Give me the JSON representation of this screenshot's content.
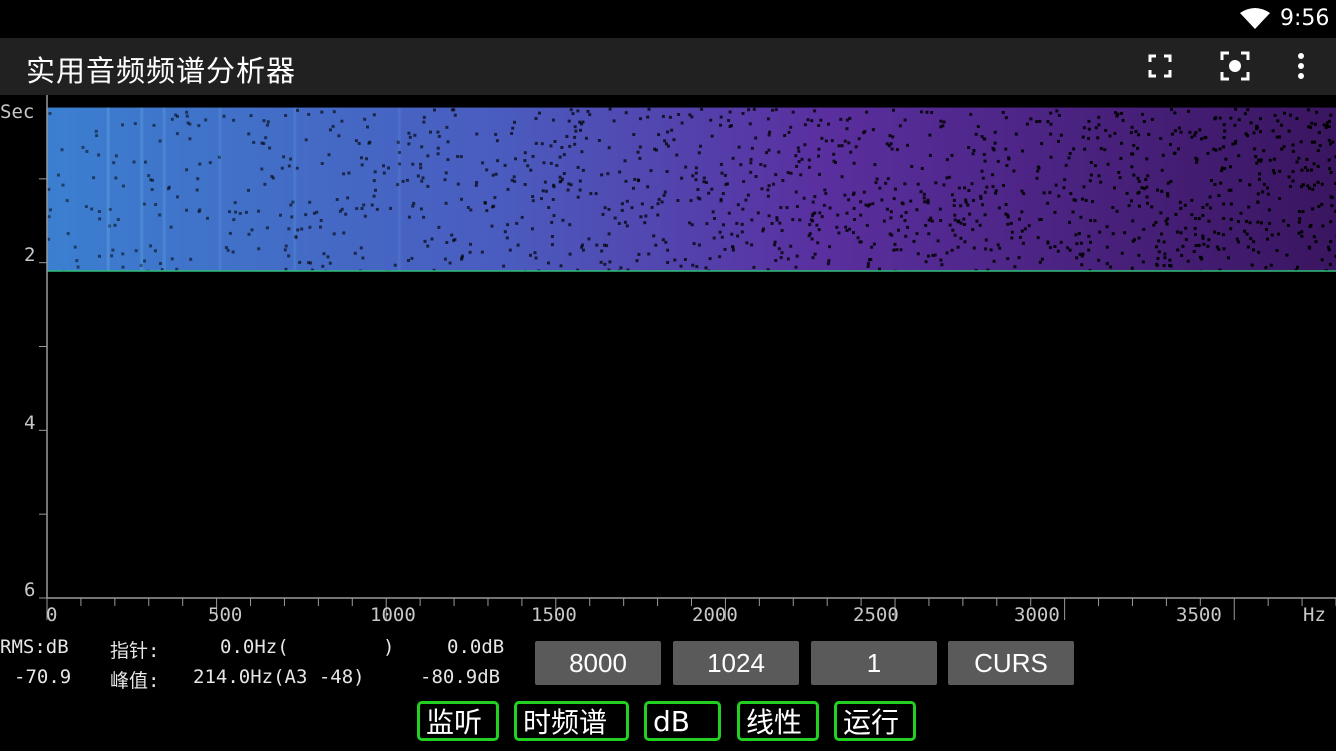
{
  "status_bar": {
    "time": "9:56",
    "wifi_icon": "wifi-icon"
  },
  "app_bar": {
    "title": "实用音频频谱分析器",
    "actions": [
      "fullscreen-icon",
      "screenshot-icon",
      "more-vert-icon"
    ]
  },
  "plot": {
    "y_axis": {
      "unit": "Sec",
      "labels": [
        "2",
        "4",
        "6"
      ],
      "range_sec": [
        0,
        6
      ]
    },
    "x_axis": {
      "unit": "Hz",
      "labels": [
        "0",
        "500",
        "1000",
        "1500",
        "2000",
        "2500",
        "3000",
        "3500"
      ],
      "range_hz": [
        0,
        3800
      ]
    },
    "spectrogram": {
      "filled_from_sec": 0.15,
      "filled_to_sec": 2.1,
      "cursor_sec": 2.1
    },
    "colors": {
      "low": "#6a2a9a",
      "high": "#3b7fd0",
      "cursor_line": "#2fc07a",
      "axis": "#9a9a9a"
    }
  },
  "readout": {
    "line1": {
      "rms_label": "RMS:dB",
      "pointer_label": "指针:",
      "pointer_freq": "0.0Hz(",
      "pointer_note": ")",
      "pointer_db": "0.0dB"
    },
    "line2": {
      "rms_value": "-70.9",
      "peak_label": "峰值:",
      "peak_freq": "214.0Hz(A3 -48)",
      "peak_db": "-80.9dB"
    }
  },
  "controls": {
    "sample_rate": "8000",
    "fft_size": "1024",
    "average": "1",
    "cursor": "CURS"
  },
  "toggles": {
    "monitor": "监听",
    "spectrogram": "时频谱",
    "db": "dB",
    "linear": "线性",
    "run": "运行"
  }
}
